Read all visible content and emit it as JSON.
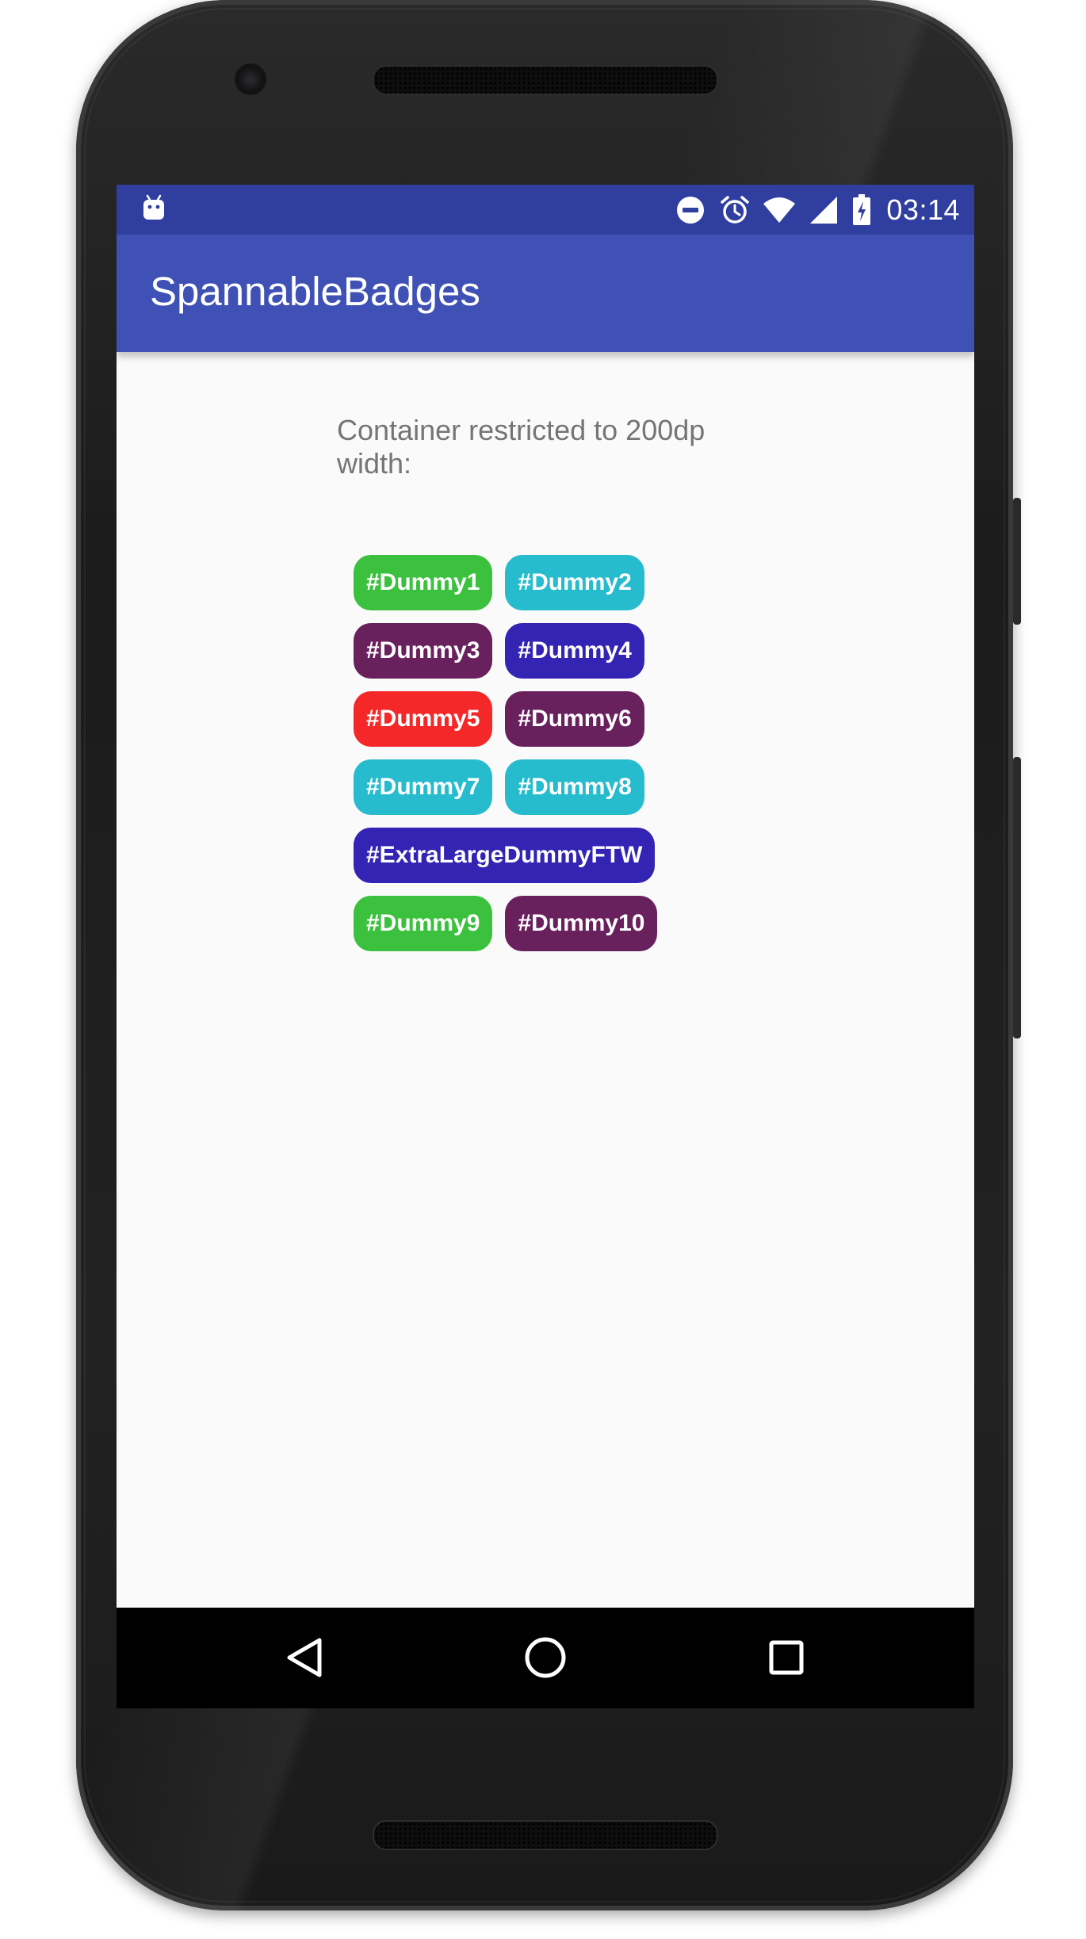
{
  "status_bar": {
    "time": "03:14",
    "background": "#303f9f",
    "icons": [
      "android-icon",
      "do-not-disturb-icon",
      "alarm-icon",
      "wifi-icon",
      "cell-signal-icon",
      "battery-charging-icon"
    ]
  },
  "app_bar": {
    "title": "SpannableBadges",
    "background": "#3f51b5"
  },
  "content": {
    "label": "Container restricted to 200dp width:",
    "badge_rows": [
      [
        {
          "text": "#Dummy1",
          "color": "#3cc13f"
        },
        {
          "text": "#Dummy2",
          "color": "#26bccd"
        }
      ],
      [
        {
          "text": "#Dummy3",
          "color": "#69215e"
        },
        {
          "text": "#Dummy4",
          "color": "#3324b3"
        }
      ],
      [
        {
          "text": "#Dummy5",
          "color": "#f42828"
        },
        {
          "text": "#Dummy6",
          "color": "#69215e"
        }
      ],
      [
        {
          "text": "#Dummy7",
          "color": "#26bccd"
        },
        {
          "text": "#Dummy8",
          "color": "#26bccd"
        }
      ],
      [
        {
          "text": "#ExtraLargeDummyFTW",
          "color": "#3324b3"
        }
      ],
      [
        {
          "text": "#Dummy9",
          "color": "#3cc13f"
        },
        {
          "text": "#Dummy10",
          "color": "#69215e"
        }
      ]
    ]
  },
  "nav_bar": {
    "buttons": [
      "back-icon",
      "home-icon",
      "recents-icon"
    ]
  }
}
